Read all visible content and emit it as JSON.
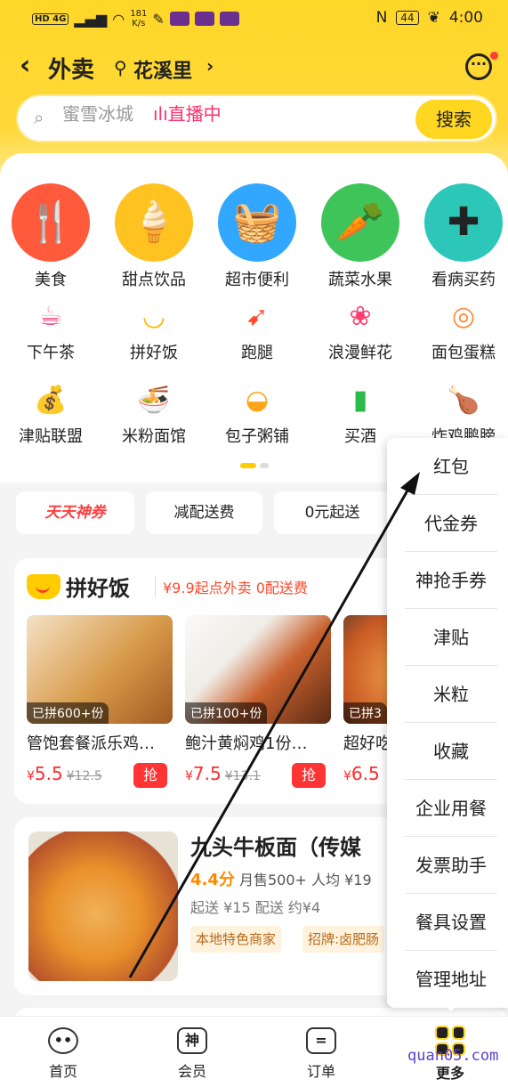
{
  "status_bar": {
    "left": "HD 4G",
    "speed_value": "181",
    "speed_unit": "K/s",
    "nfc": "N",
    "battery": "44",
    "time": "4:00"
  },
  "header": {
    "back_icon": "chevron-left-icon",
    "title": "外卖",
    "location_icon": "location-pin-icon",
    "location": "花溪里",
    "location_chevron": "›",
    "message_icon": "chat-bubble-icon"
  },
  "search": {
    "placeholder": "蜜雪冰城",
    "live_label": "直播中",
    "button": "搜索"
  },
  "categories_big": [
    {
      "label": "美食",
      "icon": "spoon-fork-icon",
      "color": "#ff5a3c"
    },
    {
      "label": "甜点饮品",
      "icon": "ice-cream-icon",
      "color": "#ffc321"
    },
    {
      "label": "超市便利",
      "icon": "basket-icon",
      "color": "#32a7ff"
    },
    {
      "label": "蔬菜水果",
      "icon": "carrot-icon",
      "color": "#3fc45a"
    },
    {
      "label": "看病买药",
      "icon": "medkit-icon",
      "color": "#2cc7b8"
    }
  ],
  "categories_small_row1": [
    {
      "label": "下午茶",
      "icon": "cup-icon"
    },
    {
      "label": "拼好饭",
      "icon": "pin-logo-icon"
    },
    {
      "label": "跑腿",
      "icon": "runner-icon"
    },
    {
      "label": "浪漫鲜花",
      "icon": "rose-icon"
    },
    {
      "label": "面包蛋糕",
      "icon": "donut-icon"
    }
  ],
  "categories_small_row2": [
    {
      "label": "津贴联盟",
      "icon": "money-bag-icon"
    },
    {
      "label": "米粉面馆",
      "icon": "noodle-bowl-icon"
    },
    {
      "label": "包子粥铺",
      "icon": "bun-icon"
    },
    {
      "label": "买酒",
      "icon": "bottle-icon"
    },
    {
      "label": "炸鸡鹏膀",
      "icon": "drumstick-icon"
    }
  ],
  "chips": [
    "天天神券",
    "减配送费",
    "0元起送"
  ],
  "pinhaofan": {
    "name": "拼好饭",
    "subtitle": "¥9.9起点外卖 0配送费",
    "products": [
      {
        "tag": "已拼600+份",
        "name": "管饱套餐派乐鸡…",
        "currency": "¥",
        "price": "5.5",
        "orig": "¥12.5",
        "grab": "抢",
        "color": "#d89a4a"
      },
      {
        "tag": "已拼100+份",
        "name": "鲍汁黄焖鸡1份…",
        "currency": "¥",
        "price": "7.5",
        "orig": "¥13.1",
        "grab": "抢",
        "color": "#c9622e"
      },
      {
        "tag": "已拼3",
        "name": "超好吃",
        "currency": "¥",
        "price": "6.5",
        "orig": "",
        "grab": "",
        "color": "#e08c3e"
      }
    ]
  },
  "shop": {
    "name": "九头牛板面（传媒",
    "rating": "4.4分",
    "monthly": "月售500+",
    "avg": "人均 ¥19",
    "delivery": "起送 ¥15  配送 约¥4",
    "tags": [
      "本地特色商家",
      "招牌:卤肥肠"
    ]
  },
  "more_menu": [
    "红包",
    "代金券",
    "神抢手券",
    "津贴",
    "米粒",
    "收藏",
    "企业用餐",
    "发票助手",
    "餐具设置",
    "管理地址"
  ],
  "tabs": [
    {
      "label": "首页",
      "icon": "home-icon",
      "glyph": "••"
    },
    {
      "label": "会员",
      "icon": "member-icon",
      "glyph": "神"
    },
    {
      "label": "订单",
      "icon": "order-icon",
      "glyph": "="
    },
    {
      "label": "更多",
      "icon": "more-grid-icon",
      "glyph": ""
    }
  ],
  "watermark": "quan05.com"
}
